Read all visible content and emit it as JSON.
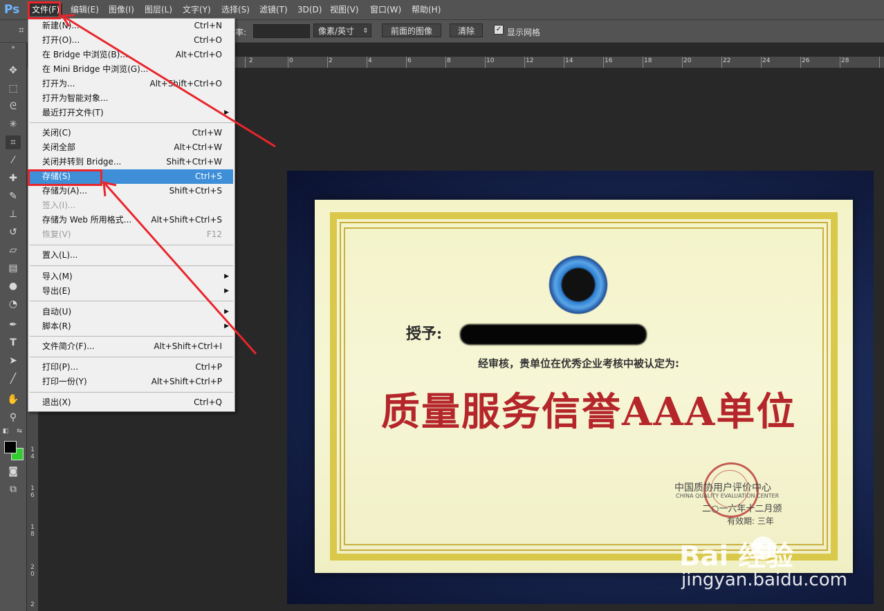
{
  "app": {
    "logo": "Ps"
  },
  "menubar": {
    "items": [
      "文件(F)",
      "编辑(E)",
      "图像(I)",
      "图层(L)",
      "文字(Y)",
      "选择(S)",
      "滤镜(T)",
      "3D(D)",
      "视图(V)",
      "窗口(W)",
      "帮助(H)"
    ]
  },
  "optionsbar": {
    "resolution_label": "率:",
    "resolution_value": "",
    "unit_select": "像素/英寸",
    "front_image_button": "前面的图像",
    "clear_button": "清除",
    "show_grid_label": "显示网格",
    "show_grid_checked": true
  },
  "file_menu": {
    "items": [
      {
        "label": "新建(N)...",
        "shortcut": "Ctrl+N"
      },
      {
        "label": "打开(O)...",
        "shortcut": "Ctrl+O"
      },
      {
        "label": "在 Bridge 中浏览(B)...",
        "shortcut": "Alt+Ctrl+O"
      },
      {
        "label": "在 Mini Bridge 中浏览(G)...",
        "shortcut": ""
      },
      {
        "label": "打开为...",
        "shortcut": "Alt+Shift+Ctrl+O"
      },
      {
        "label": "打开为智能对象...",
        "shortcut": ""
      },
      {
        "label": "最近打开文件(T)",
        "shortcut": "",
        "submenu": true
      },
      {
        "label": "关闭(C)",
        "shortcut": "Ctrl+W"
      },
      {
        "label": "关闭全部",
        "shortcut": "Alt+Ctrl+W"
      },
      {
        "label": "关闭并转到 Bridge...",
        "shortcut": "Shift+Ctrl+W"
      },
      {
        "label": "存储(S)",
        "shortcut": "Ctrl+S",
        "highlighted": true
      },
      {
        "label": "存储为(A)...",
        "shortcut": "Shift+Ctrl+S"
      },
      {
        "label": "签入(I)...",
        "shortcut": "",
        "disabled": true
      },
      {
        "label": "存储为 Web 所用格式...",
        "shortcut": "Alt+Shift+Ctrl+S"
      },
      {
        "label": "恢复(V)",
        "shortcut": "F12",
        "disabled": true
      },
      {
        "label": "置入(L)...",
        "shortcut": ""
      },
      {
        "label": "导入(M)",
        "shortcut": "",
        "submenu": true
      },
      {
        "label": "导出(E)",
        "shortcut": "",
        "submenu": true
      },
      {
        "label": "自动(U)",
        "shortcut": "",
        "submenu": true
      },
      {
        "label": "脚本(R)",
        "shortcut": "",
        "submenu": true
      },
      {
        "label": "文件简介(F)...",
        "shortcut": "Alt+Shift+Ctrl+I"
      },
      {
        "label": "打印(P)...",
        "shortcut": "Ctrl+P"
      },
      {
        "label": "打印一份(Y)",
        "shortcut": "Alt+Shift+Ctrl+P"
      },
      {
        "label": "退出(X)",
        "shortcut": "Ctrl+Q"
      }
    ]
  },
  "rulers": {
    "top_ticks": [
      "2",
      "0",
      "2",
      "4",
      "6",
      "8",
      "10",
      "12",
      "14",
      "16",
      "18",
      "20",
      "22",
      "24",
      "26",
      "28"
    ],
    "left_ticks": [
      "1\n4",
      "1\n6",
      "1\n8",
      "2\n0",
      "2"
    ]
  },
  "certificate": {
    "recipient_label": "授予:",
    "subtitle": "经审核，贵单位在优秀企业考核中被认定为:",
    "title": "质量服务信誉AAA单位",
    "issuer": "中国质协用户评价中心",
    "issuer_en": "CHINA QUALITY EVALUATION CENTER",
    "date": "二○一六年十二月颁",
    "valid": "有效期: 三年"
  },
  "watermark": {
    "logo": "Bai  经验",
    "url": "jingyan.baidu.com"
  },
  "colors": {
    "annotation": "#e8262c",
    "highlight": "#3e8fd8",
    "foreground_swatch": "#000000",
    "background_swatch": "#33cc33"
  }
}
